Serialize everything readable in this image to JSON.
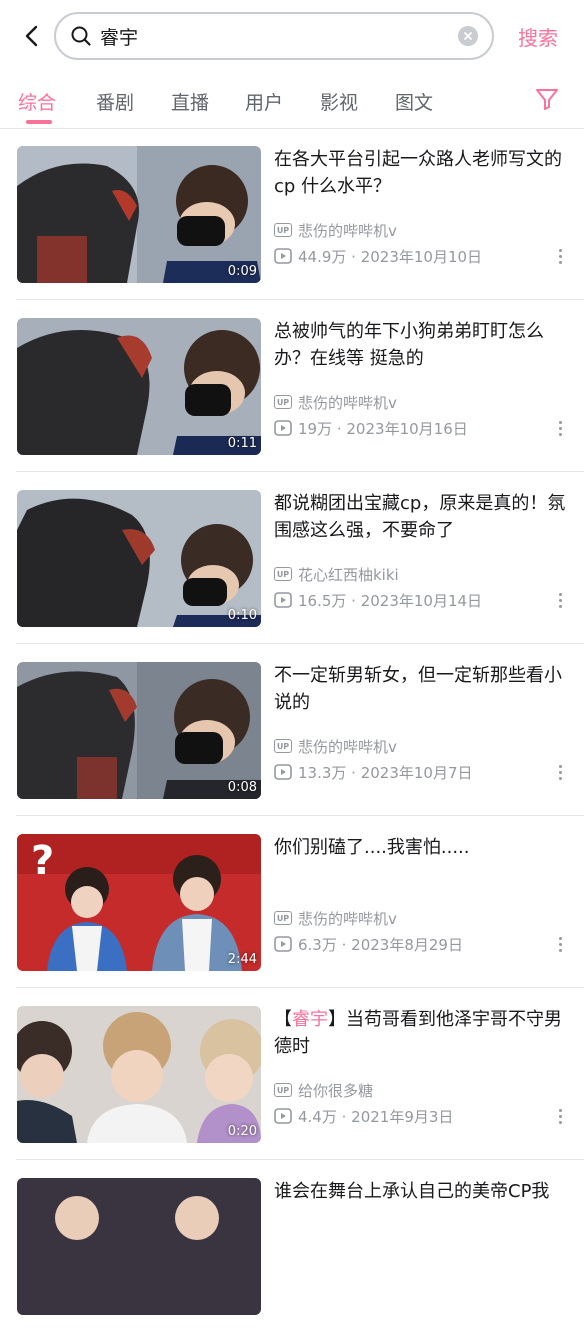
{
  "search": {
    "query": "睿宇",
    "button_label": "搜索"
  },
  "tabs": [
    {
      "label": "综合",
      "active": true
    },
    {
      "label": "番剧",
      "active": false
    },
    {
      "label": "直播",
      "active": false
    },
    {
      "label": "用户",
      "active": false
    },
    {
      "label": "影视",
      "active": false
    },
    {
      "label": "图文",
      "active": false
    }
  ],
  "accent_color": "#fb7299",
  "videos": [
    {
      "title": "在各大平台引起一众路人老师写文的cp 什么水平？",
      "title_highlight": "",
      "uploader": "悲伤的哔哔机v",
      "stats": "44.9万 · 2023年10月10日",
      "duration": "0:09"
    },
    {
      "title": "总被帅气的年下小狗弟弟盯盯怎么办？在线等 挺急的",
      "title_highlight": "",
      "uploader": "悲伤的哔哔机v",
      "stats": "19万 · 2023年10月16日",
      "duration": "0:11"
    },
    {
      "title": "都说糊团出宝藏cp，原来是真的！氛围感这么强，不要命了",
      "title_highlight": "",
      "uploader": "花心红西柚kiki",
      "stats": "16.5万 · 2023年10月14日",
      "duration": "0:10"
    },
    {
      "title": "不一定斩男斩女，但一定斩那些看小说的",
      "title_highlight": "",
      "uploader": "悲伤的哔哔机v",
      "stats": "13.3万 · 2023年10月7日",
      "duration": "0:08"
    },
    {
      "title": "你们别磕了....我害怕.....",
      "title_highlight": "",
      "uploader": "悲伤的哔哔机v",
      "stats": "6.3万 · 2023年8月29日",
      "duration": "2:44"
    },
    {
      "title": "当苟哥看到他泽宇哥不守男德时",
      "title_prefix": "【",
      "title_highlight": "睿宇",
      "title_suffix": "】",
      "uploader": "给你很多糖",
      "stats": "4.4万 · 2021年9月3日",
      "duration": "0:20"
    },
    {
      "title": "谁会在舞台上承认自己的美帝CP我",
      "title_highlight": "",
      "uploader": "",
      "stats": "",
      "duration": ""
    }
  ],
  "icons": {
    "back": "chevron-left-icon",
    "search": "search-icon",
    "clear": "clear-icon",
    "filter": "filter-icon",
    "uploader": "up-badge-icon",
    "play": "play-count-icon",
    "more": "more-vertical-icon"
  },
  "up_badge_text": "UP"
}
